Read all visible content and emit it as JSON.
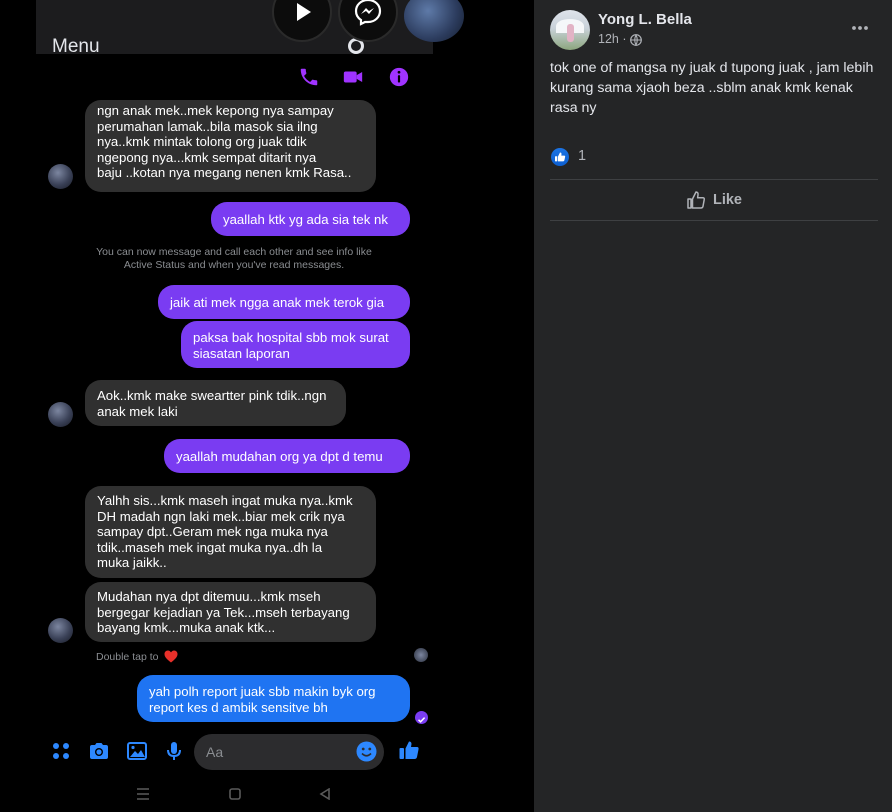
{
  "screenshot": {
    "menu_label": "Menu",
    "chat": {
      "messages": [
        {
          "dir": "in",
          "text": "ngn anak mek..mek kepong nya sampay\nperumahan lamak..bila masok sia ilng\nnya..kmk mintak tolong org juak tdik\nngepong nya...kmk sempat ditarit nya\nbaju ..kotan nya megang nenen kmk Rasa.."
        },
        {
          "dir": "out",
          "text": "yaallah ktk yg ada sia tek nk"
        },
        {
          "dir": "out",
          "text": "jaik ati mek ngga anak mek terok gia"
        },
        {
          "dir": "out",
          "text": "paksa bak hospital sbb mok surat\nsiasatan laporan"
        },
        {
          "dir": "in",
          "text": "Aok..kmk make sweartter pink tdik..ngn\nanak mek laki"
        },
        {
          "dir": "out",
          "text": "yaallah mudahan org ya dpt d temu"
        },
        {
          "dir": "in",
          "text": "Yalhh sis...kmk maseh ingat muka nya..kmk\nDH madah ngn laki mek..biar mek crik nya\nsampay dpt..Geram mek nga muka nya\ntdik..maseh mek ingat muka nya..dh la\nmuka jaikk.."
        },
        {
          "dir": "in",
          "text": "Mudahan nya dpt ditemuu...kmk mseh\nbergegar kejadian ya Tek...mseh terbayang\nbayang kmk...muka anak ktk..."
        },
        {
          "dir": "out",
          "text": "yah polh report juak sbb makin byk org\nreport kes d ambik sensitve bh"
        }
      ],
      "system_note": "You can now message and call each other and see info like\nActive Status and when you've read messages.",
      "double_tap_hint": "Double tap to",
      "input_placeholder": "Aa"
    }
  },
  "post": {
    "author": "Yong L. Bella",
    "time": "12h ·",
    "text": "tok one of mangsa ny juak d tupong juak , jam lebih kurang sama xjaoh beza ..sblm anak kmk kenak rasa ny",
    "reaction_count": "1",
    "like_label": "Like"
  },
  "colors": {
    "accent_purple": "#7a3cf2",
    "accent_blue": "#1f74f2",
    "icon_purple": "#a033ff",
    "icon_blue": "#2d88ff",
    "fb_bg": "#242526",
    "fb_text": "#e4e6eb"
  }
}
